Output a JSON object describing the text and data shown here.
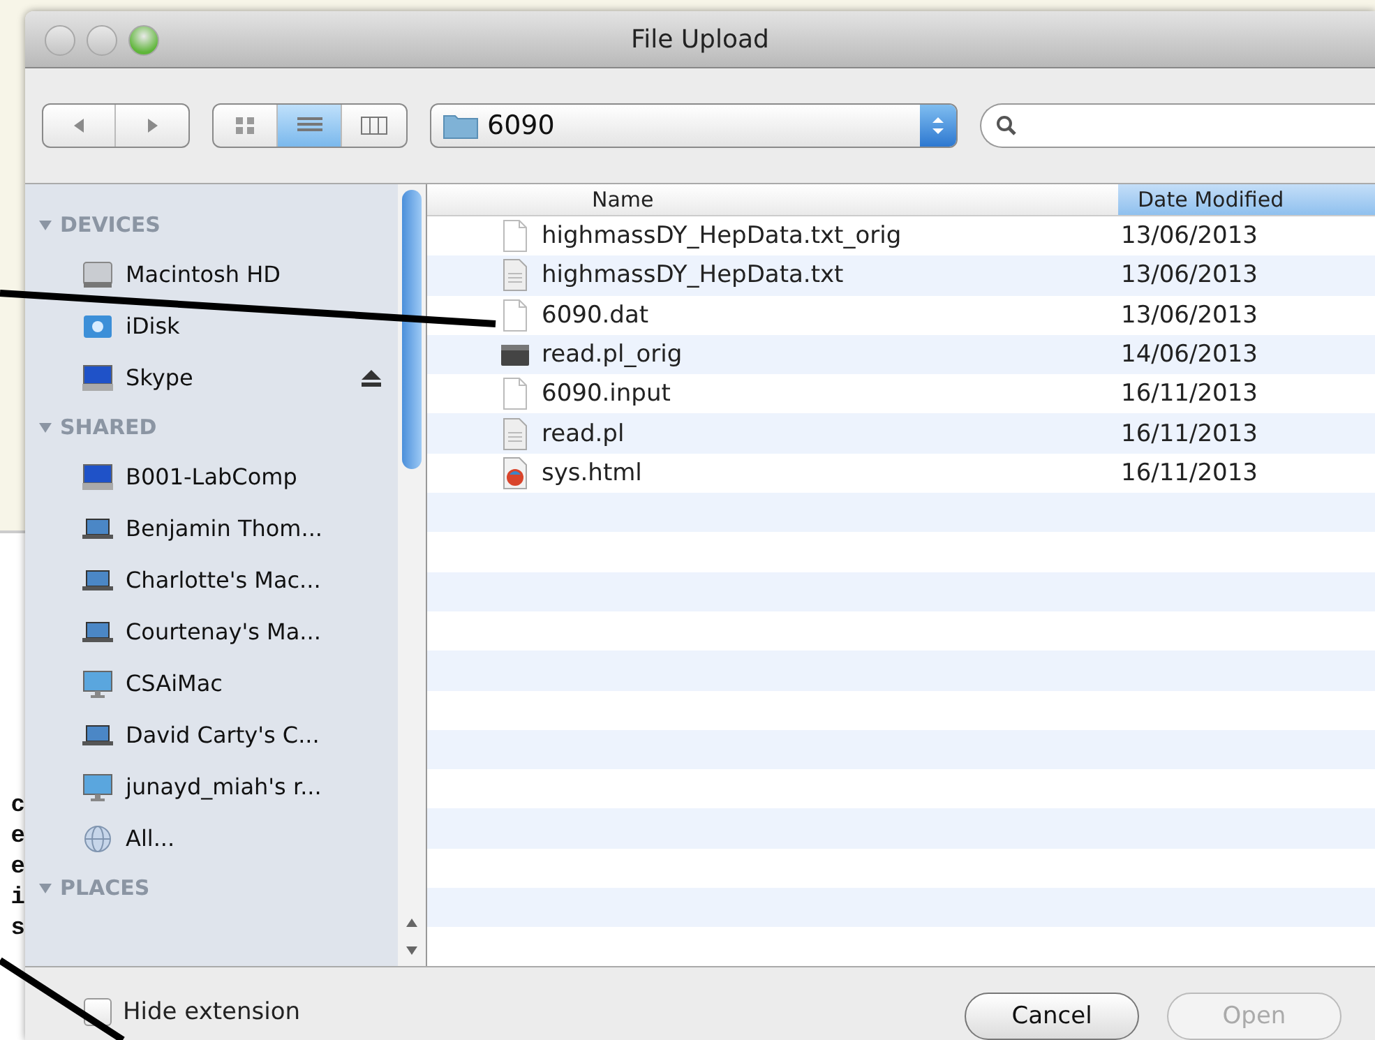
{
  "background_page": {
    "text_fragments": [
      "c",
      "e",
      "e",
      "i",
      "s"
    ]
  },
  "window": {
    "title": "File Upload",
    "traffic_lights": [
      {
        "kind": "close",
        "active": false
      },
      {
        "kind": "minimize",
        "active": false
      },
      {
        "kind": "zoom",
        "active": true
      }
    ]
  },
  "toolbar": {
    "view_modes": [
      {
        "kind": "icons",
        "selected": false
      },
      {
        "kind": "list",
        "selected": true
      },
      {
        "kind": "columns",
        "selected": false
      }
    ],
    "folder": "6090"
  },
  "sidebar": {
    "sections": [
      {
        "title": "DEVICES",
        "expanded": true,
        "items": [
          {
            "label": "Macintosh HD",
            "kind": "drive",
            "ejectable": false
          },
          {
            "label": "iDisk",
            "kind": "disk",
            "ejectable": false
          },
          {
            "label": "Skype",
            "kind": "display",
            "ejectable": true
          }
        ]
      },
      {
        "title": "SHARED",
        "expanded": true,
        "items": [
          {
            "label": "B001-LabComp",
            "kind": "display",
            "ejectable": false
          },
          {
            "label": "Benjamin Thom...",
            "kind": "laptop",
            "ejectable": false
          },
          {
            "label": "Charlotte's Mac...",
            "kind": "laptop",
            "ejectable": false
          },
          {
            "label": "Courtenay's Ma...",
            "kind": "laptop",
            "ejectable": false
          },
          {
            "label": "CSAiMac",
            "kind": "imac",
            "ejectable": false
          },
          {
            "label": "David Carty's C...",
            "kind": "laptop",
            "ejectable": false
          },
          {
            "label": "junayd_miah's r...",
            "kind": "imac",
            "ejectable": false
          },
          {
            "label": "All...",
            "kind": "network",
            "ejectable": false
          }
        ]
      },
      {
        "title": "PLACES",
        "expanded": true
      }
    ]
  },
  "file_list": {
    "columns": [
      {
        "label": "Name",
        "sorted": false
      },
      {
        "label": "Date Modified",
        "sorted": true
      }
    ],
    "rows": [
      {
        "name": "highmassDY_HepData.txt_orig",
        "date": "13/06/2013",
        "kind": "document"
      },
      {
        "name": "highmassDY_HepData.txt",
        "date": "13/06/2013",
        "kind": "text"
      },
      {
        "name": "6090.dat",
        "date": "13/06/2013",
        "kind": "document"
      },
      {
        "name": "read.pl_orig",
        "date": "14/06/2013",
        "kind": "terminal"
      },
      {
        "name": "6090.input",
        "date": "16/11/2013",
        "kind": "document"
      },
      {
        "name": "read.pl",
        "date": "16/11/2013",
        "kind": "text"
      },
      {
        "name": "sys.html",
        "date": "16/11/2013",
        "kind": "web"
      }
    ]
  },
  "footer": {
    "hide_extension": {
      "label": "Hide extension",
      "checked": false
    },
    "buttons": [
      {
        "label": "Cancel",
        "disabled": false
      },
      {
        "label": "Open",
        "disabled": true
      }
    ]
  }
}
